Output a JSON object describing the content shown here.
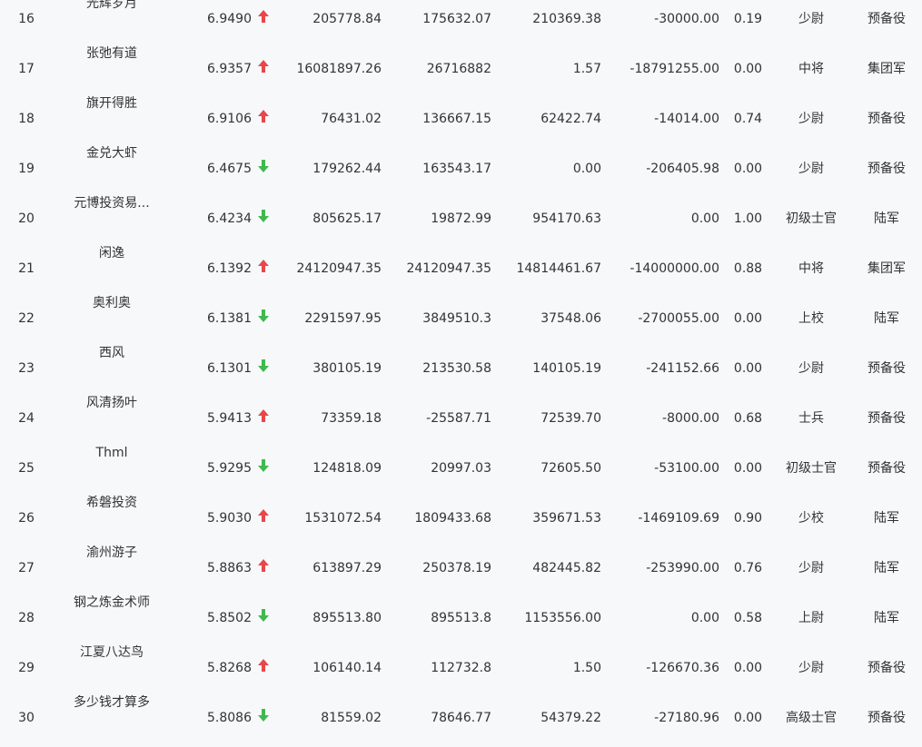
{
  "colors": {
    "up": "#e8474a",
    "down": "#3fb94e",
    "text": "#333333",
    "background": "#f7f8fa"
  },
  "rows": [
    {
      "rank": "16",
      "name": "光辉岁月",
      "score": "6.9490",
      "trend": "up",
      "v1": "205778.84",
      "v2": "175632.07",
      "v3": "210369.38",
      "v4": "-30000.00",
      "ratio": "0.19",
      "title": "少尉",
      "branch": "预备役"
    },
    {
      "rank": "17",
      "name": "张弛有道",
      "score": "6.9357",
      "trend": "up",
      "v1": "16081897.26",
      "v2": "26716882",
      "v3": "1.57",
      "v4": "-18791255.00",
      "ratio": "0.00",
      "title": "中将",
      "branch": "集团军"
    },
    {
      "rank": "18",
      "name": "旗开得胜",
      "score": "6.9106",
      "trend": "up",
      "v1": "76431.02",
      "v2": "136667.15",
      "v3": "62422.74",
      "v4": "-14014.00",
      "ratio": "0.74",
      "title": "少尉",
      "branch": "预备役"
    },
    {
      "rank": "19",
      "name": "金兑大虾",
      "score": "6.4675",
      "trend": "down",
      "v1": "179262.44",
      "v2": "163543.17",
      "v3": "0.00",
      "v4": "-206405.98",
      "ratio": "0.00",
      "title": "少尉",
      "branch": "预备役"
    },
    {
      "rank": "20",
      "name": "元博投资易...",
      "score": "6.4234",
      "trend": "down",
      "v1": "805625.17",
      "v2": "19872.99",
      "v3": "954170.63",
      "v4": "0.00",
      "ratio": "1.00",
      "title": "初级士官",
      "branch": "陆军"
    },
    {
      "rank": "21",
      "name": "闲逸",
      "score": "6.1392",
      "trend": "up",
      "v1": "24120947.35",
      "v2": "24120947.35",
      "v3": "14814461.67",
      "v4": "-14000000.00",
      "ratio": "0.88",
      "title": "中将",
      "branch": "集团军"
    },
    {
      "rank": "22",
      "name": "奥利奥",
      "score": "6.1381",
      "trend": "down",
      "v1": "2291597.95",
      "v2": "3849510.3",
      "v3": "37548.06",
      "v4": "-2700055.00",
      "ratio": "0.00",
      "title": "上校",
      "branch": "陆军"
    },
    {
      "rank": "23",
      "name": "西风",
      "score": "6.1301",
      "trend": "down",
      "v1": "380105.19",
      "v2": "213530.58",
      "v3": "140105.19",
      "v4": "-241152.66",
      "ratio": "0.00",
      "title": "少尉",
      "branch": "预备役"
    },
    {
      "rank": "24",
      "name": "风清扬叶",
      "score": "5.9413",
      "trend": "up",
      "v1": "73359.18",
      "v2": "-25587.71",
      "v3": "72539.70",
      "v4": "-8000.00",
      "ratio": "0.68",
      "title": "士兵",
      "branch": "预备役"
    },
    {
      "rank": "25",
      "name": "Thml",
      "score": "5.9295",
      "trend": "down",
      "v1": "124818.09",
      "v2": "20997.03",
      "v3": "72605.50",
      "v4": "-53100.00",
      "ratio": "0.00",
      "title": "初级士官",
      "branch": "预备役"
    },
    {
      "rank": "26",
      "name": "希磐投资",
      "score": "5.9030",
      "trend": "up",
      "v1": "1531072.54",
      "v2": "1809433.68",
      "v3": "359671.53",
      "v4": "-1469109.69",
      "ratio": "0.90",
      "title": "少校",
      "branch": "陆军"
    },
    {
      "rank": "27",
      "name": "渝州游子",
      "score": "5.8863",
      "trend": "up",
      "v1": "613897.29",
      "v2": "250378.19",
      "v3": "482445.82",
      "v4": "-253990.00",
      "ratio": "0.76",
      "title": "少尉",
      "branch": "陆军"
    },
    {
      "rank": "28",
      "name": "钢之炼金术师",
      "score": "5.8502",
      "trend": "down",
      "v1": "895513.80",
      "v2": "895513.8",
      "v3": "1153556.00",
      "v4": "0.00",
      "ratio": "0.58",
      "title": "上尉",
      "branch": "陆军"
    },
    {
      "rank": "29",
      "name": "江夏八达鸟",
      "score": "5.8268",
      "trend": "up",
      "v1": "106140.14",
      "v2": "112732.8",
      "v3": "1.50",
      "v4": "-126670.36",
      "ratio": "0.00",
      "title": "少尉",
      "branch": "预备役"
    },
    {
      "rank": "30",
      "name": "多少钱才算多",
      "score": "5.8086",
      "trend": "down",
      "v1": "81559.02",
      "v2": "78646.77",
      "v3": "54379.22",
      "v4": "-27180.96",
      "ratio": "0.00",
      "title": "高级士官",
      "branch": "预备役"
    }
  ]
}
